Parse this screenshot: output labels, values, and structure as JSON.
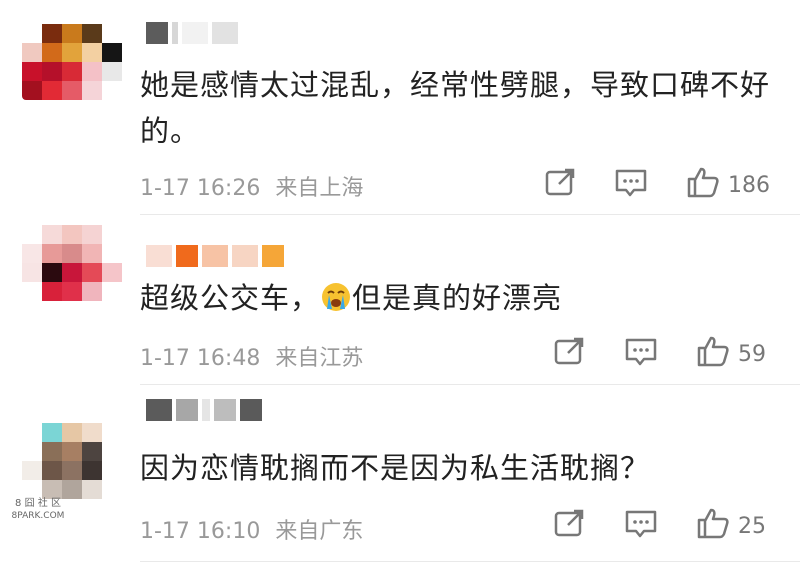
{
  "comments": [
    {
      "text": "她是感情太过混乱，经常性劈腿，导致口碑不好的。",
      "date": "1-17 16:26",
      "location": "来自上海",
      "likes": "186",
      "avatar_colors": [
        "#ffffff",
        "#7a2c0e",
        "#c97a1c",
        "#5a3a1a",
        "#ffffff",
        "#f0c9c0",
        "#d26a1a",
        "#e2a33b",
        "#f3d0a2",
        "#151515",
        "#c8112a",
        "#b5102a",
        "#d82a36",
        "#f4c1c7",
        "#e8e8e8",
        "#a3101f",
        "#e22a35",
        "#e55b67",
        "#f5d4d8",
        "#ffffff"
      ],
      "name_colors": [
        "#5c5c5c",
        "#d7d7d7",
        "#f2f2f2",
        "#e2e2e2"
      ]
    },
    {
      "text_before": "超级公交车，",
      "text_after": "但是真的好漂亮",
      "emoji": "crying-face-emoji",
      "date": "1-17 16:48",
      "location": "来自江苏",
      "likes": "59",
      "avatar_colors": [
        "#ffffff",
        "#f6dad9",
        "#f3c6c0",
        "#f5d3d3",
        "#ffffff",
        "#f8e6e6",
        "#e79a98",
        "#d88b8b",
        "#f1b5b5",
        "#ffffff",
        "#f7e4e4",
        "#2b0a0f",
        "#c8163a",
        "#e44a57",
        "#f5c5c9",
        "#ffffff",
        "#d8213a",
        "#e0304a",
        "#f0b5bd",
        "#ffffff"
      ],
      "name_colors": [
        "#f9ded4",
        "#f06a1c",
        "#f7c3a5",
        "#f7d5c3",
        "#f5a638"
      ]
    },
    {
      "text": "因为恋情耽搁而不是因为私生活耽搁？",
      "date": "1-17 16:10",
      "location": "来自广东",
      "likes": "25",
      "avatar_colors": [
        "#ffffff",
        "#7bd5d5",
        "#e6c7a5",
        "#f0dccb",
        "#ffffff",
        "#ffffff",
        "#8a6f58",
        "#a77f63",
        "#4d4440",
        "#ffffff",
        "#f2ede8",
        "#6d5648",
        "#8c7262",
        "#3d3431",
        "#ffffff",
        "#ffffff",
        "#c8bdb4",
        "#b0a59c",
        "#e4dcd5",
        "#ffffff"
      ],
      "name_colors": [
        "#5b5b5b",
        "#a7a7a7",
        "#e5e5e5",
        "#bdbdbd",
        "#5a5a5a"
      ]
    }
  ],
  "watermark": {
    "line1": "8 囧 社 区",
    "line2": "8PARK.COM"
  },
  "icons": {
    "share": "share-icon",
    "comment": "comment-icon",
    "like": "thumbs-up-icon"
  },
  "colors": {
    "text": "#222222",
    "meta": "#999999",
    "icon": "#777777"
  }
}
